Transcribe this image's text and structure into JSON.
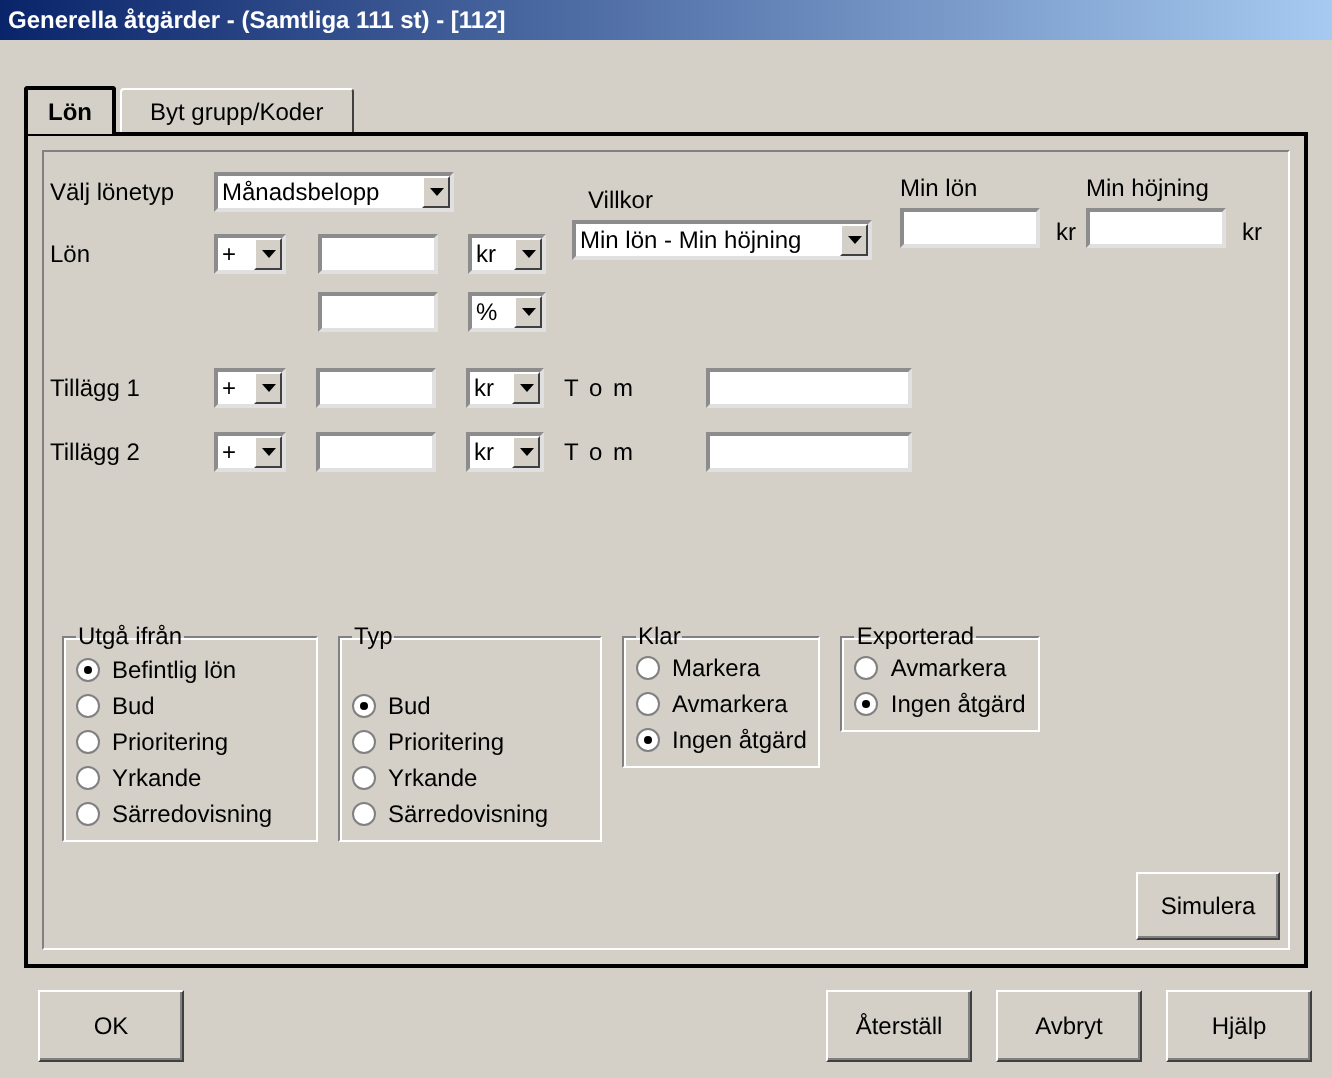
{
  "window": {
    "title": "Generella åtgärder - (Samtliga 111 st) - [112]"
  },
  "tabs": [
    {
      "label": "Lön",
      "selected": true
    },
    {
      "label": "Byt grupp/Koder",
      "selected": false
    }
  ],
  "salary_type": {
    "label": "Välj lönetyp",
    "value": "Månadsbelopp"
  },
  "salary": {
    "label": "Lön",
    "sign": "+",
    "unit": "kr",
    "percent_unit": "%"
  },
  "conditions": {
    "label": "Villkor",
    "value": "Min lön - Min höjning"
  },
  "min_salary": {
    "label": "Min lön",
    "unit": "kr"
  },
  "min_raise": {
    "label": "Min höjning",
    "unit": "kr"
  },
  "supplements": [
    {
      "label": "Tillägg 1",
      "sign": "+",
      "unit": "kr",
      "to_label": "T o m"
    },
    {
      "label": "Tillägg 2",
      "sign": "+",
      "unit": "kr",
      "to_label": "T o m"
    }
  ],
  "groups": [
    {
      "title": "Utgå ifrån",
      "fill": true,
      "options": [
        {
          "label": "Befintlig lön",
          "selected": true
        },
        {
          "label": "Bud",
          "selected": false
        },
        {
          "label": "Prioritering",
          "selected": false
        },
        {
          "label": "Yrkande",
          "selected": false
        },
        {
          "label": "Särredovisning",
          "selected": false
        }
      ]
    },
    {
      "title": "Typ",
      "fill": true,
      "options": [
        {
          "label": "Bud",
          "selected": true
        },
        {
          "label": "Prioritering",
          "selected": false
        },
        {
          "label": "Yrkande",
          "selected": false
        },
        {
          "label": "Särredovisning",
          "selected": false
        }
      ]
    },
    {
      "title": "Klar",
      "fill": false,
      "options": [
        {
          "label": "Markera",
          "selected": false
        },
        {
          "label": "Avmarkera",
          "selected": false
        },
        {
          "label": "Ingen åtgärd",
          "selected": true
        }
      ]
    },
    {
      "title": "Exporterad",
      "fill": false,
      "options": [
        {
          "label": "Avmarkera",
          "selected": false
        },
        {
          "label": "Ingen åtgärd",
          "selected": true
        }
      ]
    }
  ],
  "simulate_button": "Simulera",
  "buttons": [
    "OK",
    "Återställ",
    "Avbryt",
    "Hjälp"
  ]
}
